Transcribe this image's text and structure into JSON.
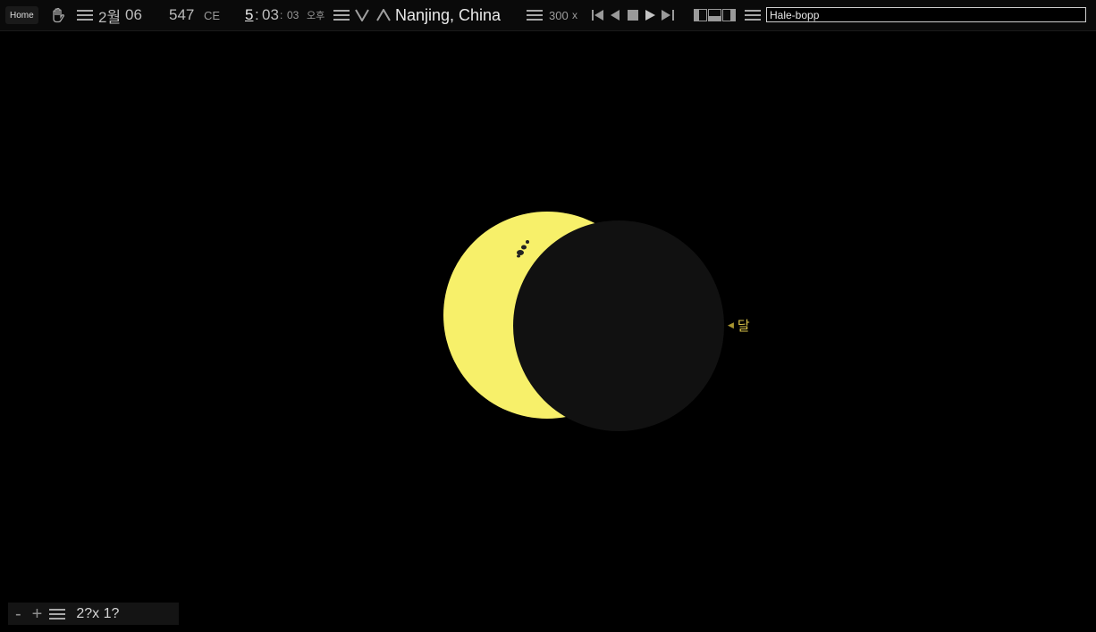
{
  "toolbar": {
    "home_label": "Home",
    "month": "2월",
    "day": "06",
    "year": "547",
    "era": "CE",
    "hour": "5",
    "hour_sep": ":",
    "minute": "03",
    "minute_sep": ":",
    "second": "03",
    "ampm": "오후",
    "location": "Nanjing, China",
    "speed": "300",
    "speed_unit": "x",
    "search_value": "Hale-bopp"
  },
  "icons": {
    "hand": "hand-icon",
    "menu": "menu-icon",
    "down": "chevron-down-icon",
    "up": "chevron-up-icon"
  },
  "sky": {
    "moon_label": "달",
    "sun_color": "#f7f06a",
    "moon_color": "#111111"
  },
  "bottom": {
    "zoom_out": "-",
    "zoom_in": "+",
    "fov_text": "2?x 1?"
  }
}
